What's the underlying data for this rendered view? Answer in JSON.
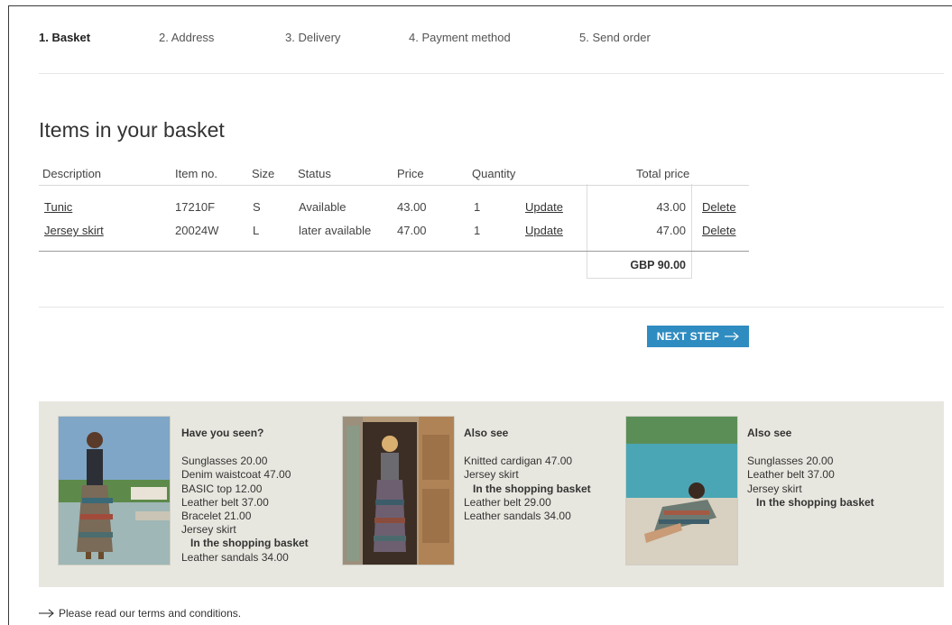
{
  "steps": [
    {
      "label": "1. Basket",
      "active": true
    },
    {
      "label": "2. Address",
      "active": false
    },
    {
      "label": "3. Delivery",
      "active": false
    },
    {
      "label": "4. Payment method",
      "active": false
    },
    {
      "label": "5. Send order",
      "active": false
    }
  ],
  "heading": "Items in your basket",
  "table": {
    "headers": {
      "description": "Description",
      "item_no": "Item no.",
      "size": "Size",
      "status": "Status",
      "price": "Price",
      "quantity": "Quantity",
      "total_price": "Total price"
    },
    "rows": [
      {
        "description": "Tunic",
        "item_no": "17210F",
        "size": "S",
        "status": "Available",
        "price": "43.00",
        "quantity": "1",
        "update": "Update",
        "total": "43.00",
        "delete": "Delete"
      },
      {
        "description": "Jersey skirt",
        "item_no": "20024W",
        "size": "L",
        "status": "later available",
        "price": "47.00",
        "quantity": "1",
        "update": "Update",
        "total": "47.00",
        "delete": "Delete"
      }
    ],
    "grand_total": "GBP 90.00"
  },
  "next_step": {
    "label": "NEXT STEP",
    "icon": "arrow-right-icon"
  },
  "recommendations": [
    {
      "heading": "Have you seen?",
      "items": [
        {
          "text": "Sunglasses 20.00",
          "in_basket": false
        },
        {
          "text": "Denim waistcoat 47.00",
          "in_basket": false
        },
        {
          "text": "BASIC top 12.00",
          "in_basket": false
        },
        {
          "text": "Leather belt 37.00",
          "in_basket": false
        },
        {
          "text": "Bracelet 21.00",
          "in_basket": false
        },
        {
          "text": "Jersey skirt",
          "in_basket": false
        },
        {
          "text": "In the shopping basket",
          "in_basket": true
        },
        {
          "text": "Leather sandals 34.00",
          "in_basket": false
        }
      ]
    },
    {
      "heading": "Also see",
      "items": [
        {
          "text": "Knitted cardigan 47.00",
          "in_basket": false
        },
        {
          "text": "Jersey skirt",
          "in_basket": false
        },
        {
          "text": "In the shopping basket",
          "in_basket": true
        },
        {
          "text": "Leather belt 29.00",
          "in_basket": false
        },
        {
          "text": "Leather sandals 34.00",
          "in_basket": false
        }
      ]
    },
    {
      "heading": "Also see",
      "items": [
        {
          "text": "Sunglasses 20.00",
          "in_basket": false
        },
        {
          "text": "Leather belt 37.00",
          "in_basket": false
        },
        {
          "text": "Jersey skirt",
          "in_basket": false
        },
        {
          "text": "In the shopping basket",
          "in_basket": true
        }
      ]
    }
  ],
  "terms": "Please read our terms and conditions.",
  "colors": {
    "accent": "#2f8cc0",
    "promo_bg": "#e8e7df"
  }
}
